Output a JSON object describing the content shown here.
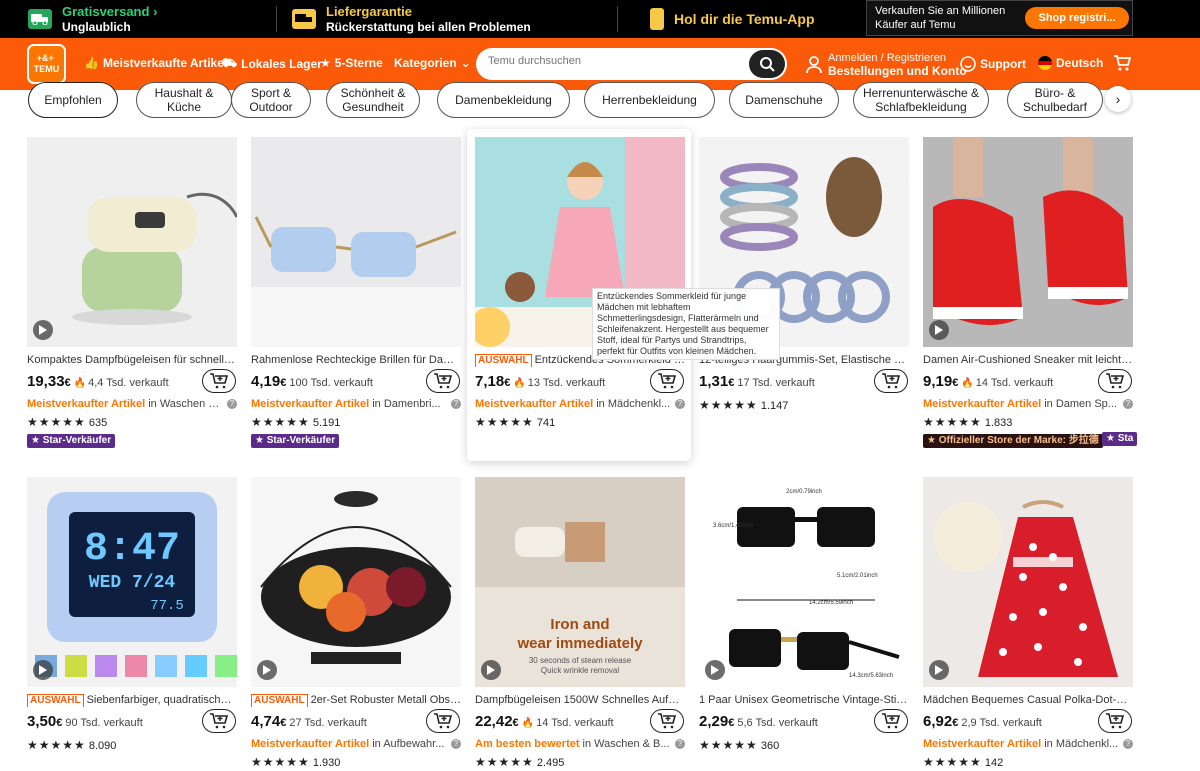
{
  "promo": {
    "shipping_title": "Gratisversand",
    "shipping_sub": "Unglaublich",
    "guarantee_title": "Liefergarantie",
    "guarantee_sub": "Rückerstattung bei allen Problemen",
    "app": "Hol dir die Temu-App",
    "seller_text_1": "Verkaufen Sie an Millionen",
    "seller_text_2": "Käufer auf Temu",
    "seller_button": "Shop registri..."
  },
  "header": {
    "logo_top": "+&+ ",
    "logo_bottom": "TEMU",
    "nav": [
      "Meistverkaufte Artikel",
      "Lokales Lager",
      "5-Sterne",
      "Kategorien"
    ],
    "search_placeholder": "Temu durchsuchen",
    "account_1": "Anmelden / Registrieren",
    "account_2": "Bestellungen und Konto",
    "support": "Support",
    "language": "Deutsch"
  },
  "categories": [
    "Empfohlen",
    "Haushalt & Küche",
    "Sport & Outdoor",
    "Schönheit & Gesundheit",
    "Damenbekleidung",
    "Herrenbekleidung",
    "Damenschuhe",
    "Herrenunterwäsche & Schlafbekleidung",
    "Büro- & Schulbedarf"
  ],
  "tooltip": "Entzückendes Sommerkleid für junge Mädchen mit lebhaftem Schmetterlingsdesign, Flatterärmeln und Schleifenakzent. Hergestellt aus bequemer Stoff, ideal für Partys und Strandtrips, perfekt für Outfits von kleinen Mädchen.",
  "products": [
    {
      "tag": "",
      "title": "Kompaktes Dampfbügeleisen für schnelle ...",
      "price_main": "19,33",
      "price_cur": "€",
      "flame": true,
      "sold": "4,4 Tsd. verkauft",
      "best_label": "Meistverkaufter Artikel",
      "best_in": "in Waschen &...",
      "stars": "★★★★★",
      "reviews": "635",
      "badge": "★ Star-Verkäufer"
    },
    {
      "tag": "",
      "title": "Rahmenlose Rechteckige Brillen für Damen...",
      "price_main": "4,19",
      "price_cur": "€",
      "flame": false,
      "sold": "100 Tsd. verkauft",
      "best_label": "Meistverkaufter Artikel",
      "best_in": "in Damenbri...",
      "stars": "★★★★★",
      "reviews": "5.191",
      "badge": "★ Star-Verkäufer"
    },
    {
      "tag": "AUSWAHL",
      "title": "Entzückendes Sommerkleid für ...",
      "price_main": "7,18",
      "price_cur": "€",
      "flame": true,
      "sold": "13 Tsd. verkauft",
      "best_label": "Meistverkaufter Artikel",
      "best_in": "in Mädchenkl...",
      "stars": "★★★★★",
      "reviews": "741",
      "badge": ""
    },
    {
      "tag": "",
      "title": "12-teiliges Haargummis-Set, Elastische Pfe...",
      "price_main": "1,31",
      "price_cur": "€",
      "flame": false,
      "sold": "17 Tsd. verkauft",
      "best_label": "",
      "best_in": "",
      "stars": "★★★★★",
      "reviews": "1.147",
      "badge": ""
    },
    {
      "tag": "",
      "title": "Damen Air-Cushioned Sneaker mit leichter...",
      "price_main": "9,19",
      "price_cur": "€",
      "flame": true,
      "sold": "14 Tsd. verkauft",
      "best_label": "Meistverkaufter Artikel",
      "best_in": "in Damen Sp...",
      "stars": "★★★★★",
      "reviews": "1.833",
      "badge": "★ Offizieller Store der Marke: 步拉德"
    },
    {
      "tag": "AUSWAHL",
      "title": "Siebenfarbiger, quadratischer ...",
      "price_main": "3,50",
      "price_cur": "€",
      "flame": false,
      "sold": "90 Tsd. verkauft",
      "best_label": "",
      "best_in": "",
      "stars": "★★★★★",
      "reviews": "8.090",
      "badge": ""
    },
    {
      "tag": "AUSWAHL",
      "title": "2er-Set Robuster Metall Obstk...",
      "price_main": "4,74",
      "price_cur": "€",
      "flame": false,
      "sold": "27 Tsd. verkauft",
      "best_label": "Meistverkaufter Artikel",
      "best_in": "in Aufbewahr...",
      "stars": "★★★★★",
      "reviews": "1.930",
      "badge": ""
    },
    {
      "tag": "",
      "title": "Dampfbügeleisen 1500W Schnelles Aufhei...",
      "price_main": "22,42",
      "price_cur": "€",
      "flame": true,
      "sold": "14 Tsd. verkauft",
      "best_label": "Am besten bewertet",
      "best_in": "in Waschen & B...",
      "stars": "★★★★★",
      "reviews": "2.495",
      "badge": ""
    },
    {
      "tag": "",
      "title": "1 Paar Unisex Geometrische Vintage-Stil M...",
      "price_main": "2,29",
      "price_cur": "€",
      "flame": false,
      "sold": "5,6 Tsd. verkauft",
      "best_label": "",
      "best_in": "",
      "stars": "★★★★★",
      "reviews": "360",
      "badge": ""
    },
    {
      "tag": "",
      "title": "Mädchen Bequemes Casual Polka-Dot-Klei...",
      "price_main": "6,92",
      "price_cur": "€",
      "flame": false,
      "sold": "2,9 Tsd. verkauft",
      "best_label": "Meistverkaufter Artikel",
      "best_in": "in Mädchenkl...",
      "stars": "★★★★★",
      "reviews": "142",
      "badge": ""
    }
  ],
  "images": {
    "clock_time": "8:47",
    "clock_day": "WED 7/24",
    "clock_temp": "77.5",
    "steam_1": "Iron and",
    "steam_2": "wear immediately",
    "steam_3": "30 seconds of steam release",
    "steam_4": "Quick wrinkle removal",
    "glasses_dim_1": "2cm/0.79inch",
    "glasses_dim_2": "3.6cm/1.42inch",
    "glasses_dim_3": "5.1cm/2.01inch",
    "glasses_dim_4": "14.2cm/5.59inch",
    "glasses_dim_5": "14.3cm/5.63inch"
  },
  "stray_badge": "★ Sta",
  "colors": {
    "brand": "#fb5b09",
    "accent": "#fb7701",
    "badge": "#5b2b8a"
  }
}
